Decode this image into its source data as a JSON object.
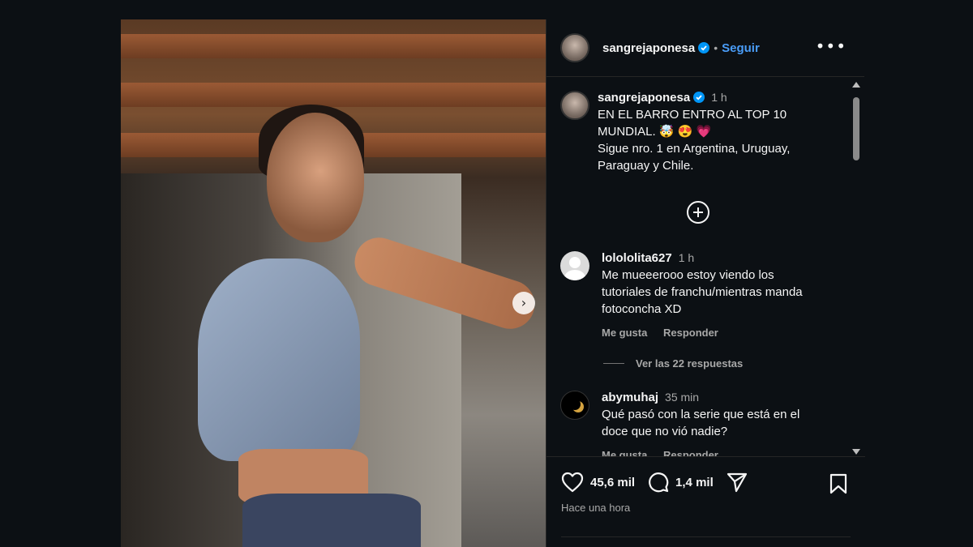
{
  "post": {
    "username": "sangrejaponesa",
    "separator": "•",
    "follow_label": "Seguir",
    "more_label": "•••",
    "next_label": "›"
  },
  "caption": {
    "username": "sangrejaponesa",
    "time": "1 h",
    "lines": [
      "EN EL BARRO ENTRO AL TOP 10",
      "MUNDIAL. 🤯 😍 💗",
      "Sigue nro. 1 en Argentina, Uruguay,",
      "Paraguay y Chile."
    ]
  },
  "comments": [
    {
      "username": "lolololita627",
      "time": "1 h",
      "lines": [
        "Me mueeerooo estoy viendo los",
        "tutoriales de franchu/mientras manda",
        "fotoconcha XD"
      ],
      "like_label": "Me gusta",
      "reply_label": "Responder"
    },
    {
      "username": "abymuhaj",
      "time": "35 min",
      "lines": [
        "Qué pasó con la serie que está en el",
        "doce que no vió nadie?"
      ],
      "like_label": "Me gusta",
      "reply_label": "Responder"
    }
  ],
  "replies_label": "Ver las 22 respuestas",
  "stats": {
    "likes": "45,6 mil",
    "comments": "1,4 mil",
    "posted": "Hace una hora"
  },
  "colors": {
    "accent": "#4a9df8",
    "verified": "#0095f6",
    "background": "#0c1014"
  }
}
